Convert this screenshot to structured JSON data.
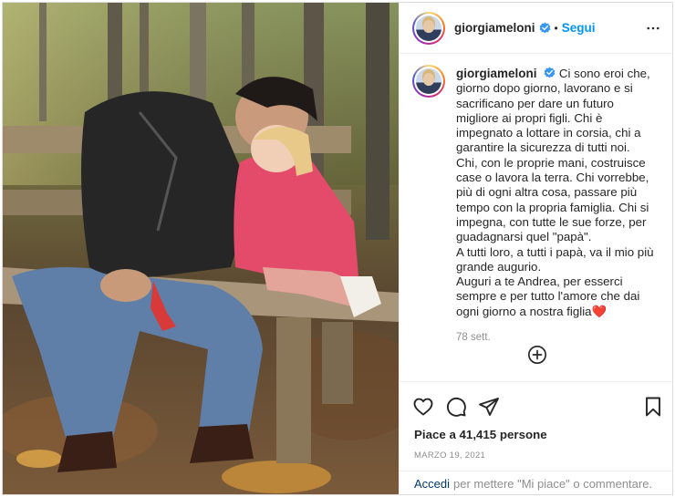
{
  "post": {
    "username": "giorgiameloni",
    "follow_label": "Segui",
    "caption_username": "giorgiameloni",
    "caption": "Ci sono eroi che, giorno dopo giorno, lavorano e si sacrificano per dare un futuro migliore ai propri figli. Chi è impegnato a lottare in corsia, chi a garantire la sicurezza di tutti noi. Chi, con le proprie mani, costruisce case o lavora la terra. Chi vorrebbe, più di ogni altra cosa, passare più tempo con la propria famiglia. Chi si impegna, con tutte le sue forze, per guadagnarsi quel \"papà\".\nA tutti loro, a tutti i papà, va il mio più grande augurio.\nAuguri a te Andrea, per esserci sempre e per tutto l'amore che dai ogni giorno a nostra figlia❤️",
    "caption_age": "78 sett.",
    "likes": "Piace a 41,415 persone",
    "date": "MARZO 19, 2021",
    "login_label": "Accedi",
    "comment_prompt": "per mettere \"Mi piace\" o commentare."
  },
  "colors": {
    "follow": "#0095f6",
    "verified": "#3897f0",
    "heart": "#e0245e",
    "muted": "#8e8e8e",
    "link": "#00376b"
  },
  "icons": {
    "more": "more-horizontal-icon",
    "verified": "verified-badge-icon",
    "add": "add-comment-icon",
    "like": "heart-outline-icon",
    "comment": "comment-bubble-icon",
    "share": "paper-plane-icon",
    "save": "bookmark-icon"
  }
}
